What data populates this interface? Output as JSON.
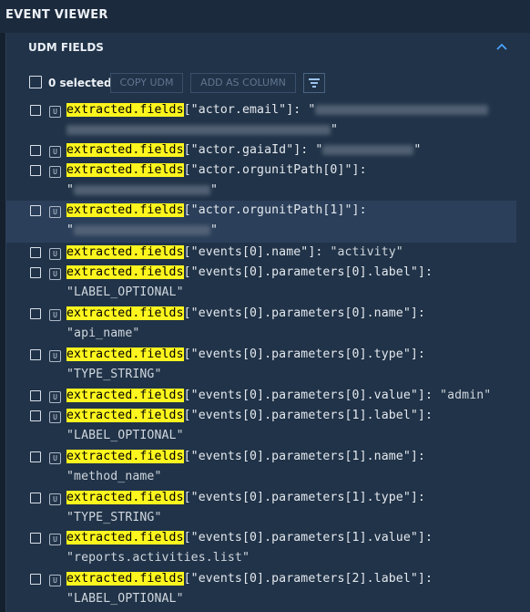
{
  "app": {
    "title": "EVENT VIEWER"
  },
  "panel": {
    "title": "UDM FIELDS",
    "toolbar": {
      "selected_label": "0 selected",
      "copy_label": "COPY UDM",
      "add_label": "ADD AS COLUMN"
    }
  },
  "rows": [
    {
      "key": "extracted.fields",
      "l1": "[\"actor.email\"]: \"",
      "l2": "\""
    },
    {
      "key": "extracted.fields",
      "l1": "[\"actor.gaiaId\"]: \"",
      "tail": "\""
    },
    {
      "key": "extracted.fields",
      "l1": "[\"actor.orgunitPath[0]\"]:",
      "l2": "\"",
      "l2tail": "\""
    },
    {
      "key": "extracted.fields",
      "l1": "[\"actor.orgunitPath[1]\"]:",
      "l2": "\"",
      "l2tail": "\""
    },
    {
      "key": "extracted.fields",
      "l1": "[\"events[0].name\"]: ",
      "v1": "\"activity\""
    },
    {
      "key": "extracted.fields",
      "l1": "[\"events[0].parameters[0].label\"]:",
      "v2": "\"LABEL_OPTIONAL\""
    },
    {
      "key": "extracted.fields",
      "l1": "[\"events[0].parameters[0].name\"]:",
      "v2": "\"api_name\""
    },
    {
      "key": "extracted.fields",
      "l1": "[\"events[0].parameters[0].type\"]:",
      "v2": "\"TYPE_STRING\""
    },
    {
      "key": "extracted.fields",
      "l1": "[\"events[0].parameters[0].value\"]: ",
      "v1": "\"admin\""
    },
    {
      "key": "extracted.fields",
      "l1": "[\"events[0].parameters[1].label\"]:",
      "v2": "\"LABEL_OPTIONAL\""
    },
    {
      "key": "extracted.fields",
      "l1": "[\"events[0].parameters[1].name\"]:",
      "v2": "\"method_name\""
    },
    {
      "key": "extracted.fields",
      "l1": "[\"events[0].parameters[1].type\"]:",
      "v2": "\"TYPE_STRING\""
    },
    {
      "key": "extracted.fields",
      "l1": "[\"events[0].parameters[1].value\"]:",
      "v2": "\"reports.activities.list\""
    },
    {
      "key": "extracted.fields",
      "l1": "[\"events[0].parameters[2].label\"]:",
      "v2": "\"LABEL_OPTIONAL\""
    }
  ],
  "icons": {
    "collapse": "chevron-up-icon",
    "filter": "filter-icon",
    "udm_badge": "U"
  },
  "colors": {
    "background": "#1b2a3d",
    "panel": "#213348",
    "highlight": "#fdf51e",
    "accent": "#4aa3ff"
  }
}
